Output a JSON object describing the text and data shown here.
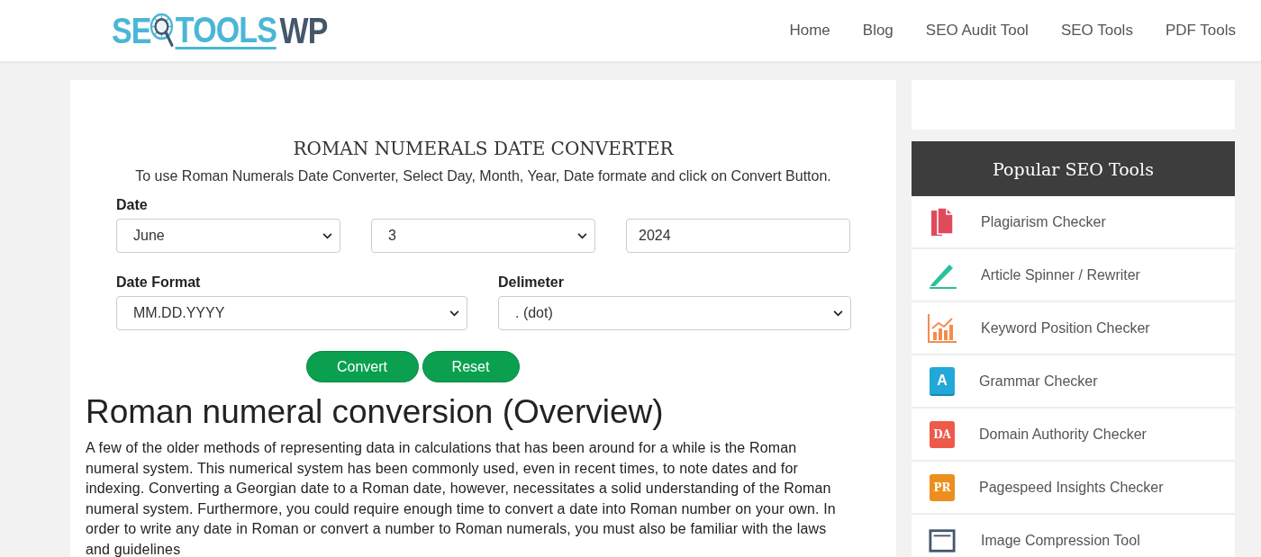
{
  "logo": {
    "part_1": "SE",
    "part_2": "TOOLS",
    "part_3": "WP"
  },
  "nav": [
    "Home",
    "Blog",
    "SEO Audit Tool",
    "SEO Tools",
    "PDF Tools"
  ],
  "converter": {
    "title": "ROMAN NUMERALS DATE CONVERTER",
    "instructions": "To use Roman Numerals Date Converter, Select Day, Month, Year, Date formate and click on Convert Button.",
    "date_label": "Date",
    "month": "June",
    "day": "3",
    "year": "2024",
    "format_label": "Date Format",
    "format": "MM.DD.YYYY",
    "delimiter_label": "Delimeter",
    "delimiter": ". (dot)",
    "buttons": [
      "Convert",
      "Reset"
    ]
  },
  "article": {
    "heading": "Roman numeral conversion (Overview)",
    "paragraph": "A few of the older methods of representing data in calculations that has been around for a while is the Roman numeral system. This numerical system has been commonly used, even in recent times, to note dates and for indexing. Converting a Georgian date to a Roman date, however, necessitates a solid understanding of the Roman numeral system. Furthermore, you could require enough time to convert a date into Roman number on your own. In order to write any date in Roman or convert a number to Roman numerals, you must also be familiar with the laws and guidelines"
  },
  "sidebar": {
    "title": "Popular SEO Tools",
    "items": [
      {
        "kind": "pages",
        "label": "Plagiarism Checker"
      },
      {
        "kind": "pencil",
        "label": "Article Spinner / Rewriter"
      },
      {
        "kind": "chart",
        "label": "Keyword Position Checker"
      },
      {
        "kind": "book",
        "label": "Grammar Checker",
        "icon_text": "A"
      },
      {
        "kind": "badge",
        "label": "Domain Authority Checker",
        "icon_text": "DA",
        "color": "#ee5a4a"
      },
      {
        "kind": "badge",
        "label": "Pagespeed Insights Checker",
        "icon_text": "PR",
        "color": "#ec8f1e"
      },
      {
        "kind": "image",
        "label": "Image Compression Tool"
      }
    ]
  }
}
